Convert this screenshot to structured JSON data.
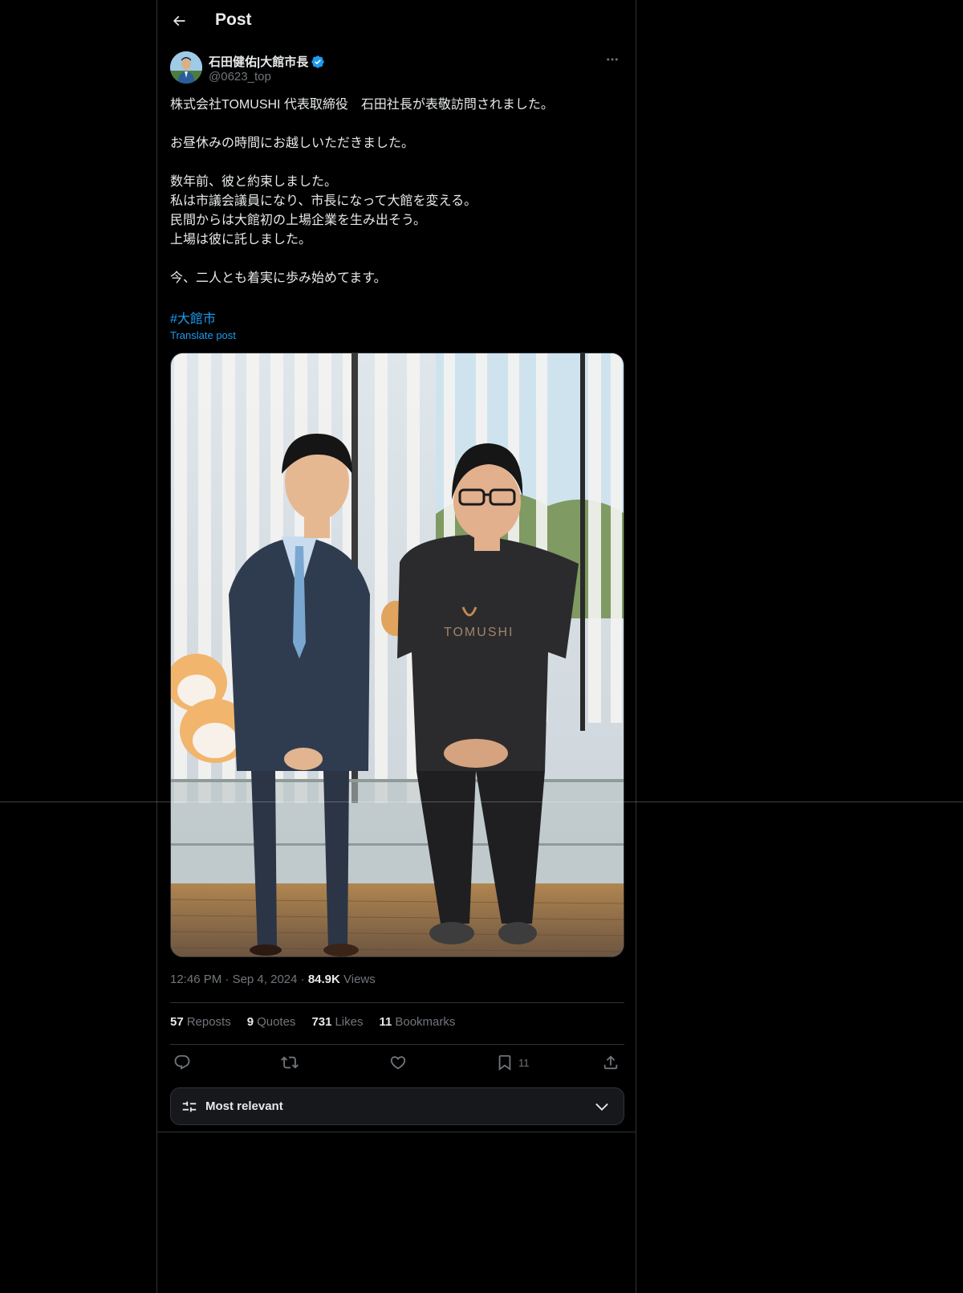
{
  "header": {
    "title": "Post"
  },
  "author": {
    "name": "石田健佑|大館市長",
    "handle": "@0623_top",
    "verified": true
  },
  "post": {
    "lines": [
      "株式会社TOMUSHI 代表取締役　石田社長が表敬訪問されました。",
      "",
      "お昼休みの時間にお越しいただきました。",
      "",
      "数年前、彼と約束しました。",
      "私は市議会議員になり、市長になって大館を変える。",
      "民間からは大館初の上場企業を生み出そう。",
      "上場は彼に託しました。",
      "",
      "今、二人とも着実に歩み始めてます。"
    ],
    "hashtag": "#大館市",
    "translate_label": "Translate post",
    "shirt_text": "TOMUSHI"
  },
  "meta": {
    "time": "12:46 PM",
    "date": "Sep 4, 2024",
    "views_count": "84.9K",
    "views_label": "Views"
  },
  "stats": {
    "reposts_count": "57",
    "reposts_label": "Reposts",
    "quotes_count": "9",
    "quotes_label": "Quotes",
    "likes_count": "731",
    "likes_label": "Likes",
    "bookmarks_count": "11",
    "bookmarks_label": "Bookmarks"
  },
  "actions": {
    "bookmark_count": "11"
  },
  "sort": {
    "label": "Most relevant"
  },
  "colors": {
    "background": "#000000",
    "text": "#e7e9ea",
    "muted": "#71767b",
    "accent": "#1d9bf0",
    "border": "#2f3336"
  }
}
